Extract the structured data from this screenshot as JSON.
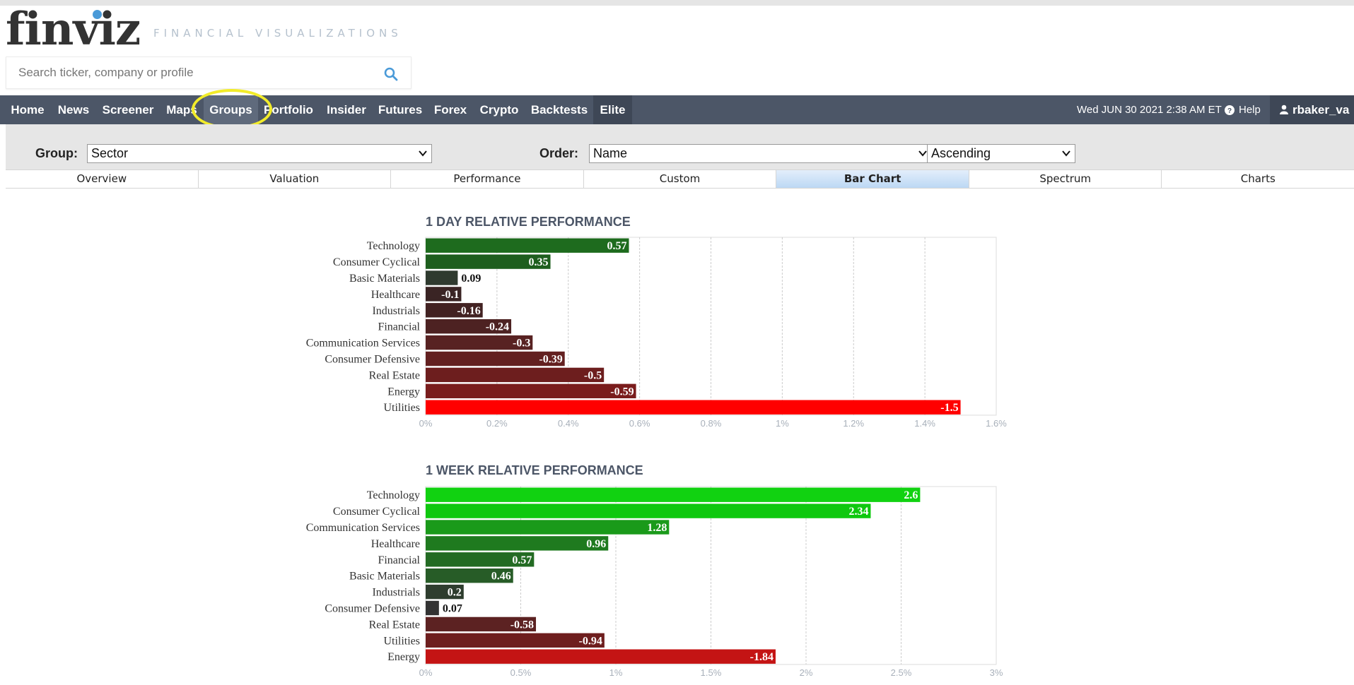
{
  "header": {
    "logo": "finviz",
    "tagline": "FINANCIAL VISUALIZATIONS",
    "search_placeholder": "Search ticker, company or profile"
  },
  "nav": {
    "items": [
      "Home",
      "News",
      "Screener",
      "Maps",
      "Groups",
      "Portfolio",
      "Insider",
      "Futures",
      "Forex",
      "Crypto",
      "Backtests",
      "Elite"
    ],
    "active": "Groups",
    "datetime": "Wed JUN 30 2021 2:38 AM ET",
    "help": "Help",
    "user": "rbaker_va"
  },
  "controls": {
    "group_label": "Group:",
    "group_value": "Sector",
    "order_label": "Order:",
    "order_value": "Name",
    "direction_value": "Ascending"
  },
  "tabs": [
    "Overview",
    "Valuation",
    "Performance",
    "Custom",
    "Bar Chart",
    "Spectrum",
    "Charts"
  ],
  "active_tab": "Bar Chart",
  "colors": {
    "nav_bg": "#4c5667",
    "highlight": "#f2ec2a",
    "positive_strong": "#00cc00",
    "negative_strong": "#ff0000"
  },
  "chart_data": [
    {
      "type": "bar",
      "title": "1 DAY RELATIVE PERFORMANCE",
      "categories": [
        "Technology",
        "Consumer Cyclical",
        "Basic Materials",
        "Healthcare",
        "Industrials",
        "Financial",
        "Communication Services",
        "Consumer Defensive",
        "Real Estate",
        "Energy",
        "Utilities"
      ],
      "values": [
        0.57,
        0.35,
        0.09,
        -0.1,
        -0.16,
        -0.24,
        -0.3,
        -0.39,
        -0.5,
        -0.59,
        -1.5
      ],
      "value_labels": [
        "0.57",
        "0.35",
        "0.09",
        "-0.1",
        "-0.16",
        "-0.24",
        "-0.3",
        "-0.39",
        "-0.5",
        "-0.59",
        "-1.5"
      ],
      "xlim": [
        0,
        1.6
      ],
      "xticks": [
        "0%",
        "0.2%",
        "0.4%",
        "0.6%",
        "0.8%",
        "1%",
        "1.2%",
        "1.4%",
        "1.6%"
      ],
      "bar_colors": [
        "#1e6b1e",
        "#1e5e1e",
        "#2f3a2f",
        "#3a2424",
        "#422222",
        "#4d2222",
        "#582222",
        "#632020",
        "#6d1e1e",
        "#7a1c1c",
        "#ff0000"
      ],
      "grid": true
    },
    {
      "type": "bar",
      "title": "1 WEEK RELATIVE PERFORMANCE",
      "categories": [
        "Technology",
        "Consumer Cyclical",
        "Communication Services",
        "Healthcare",
        "Financial",
        "Basic Materials",
        "Industrials",
        "Consumer Defensive",
        "Real Estate",
        "Utilities",
        "Energy"
      ],
      "values": [
        2.6,
        2.34,
        1.28,
        0.96,
        0.57,
        0.46,
        0.2,
        0.07,
        -0.58,
        -0.94,
        -1.84
      ],
      "value_labels": [
        "2.6",
        "2.34",
        "1.28",
        "0.96",
        "0.57",
        "0.46",
        "0.2",
        "0.07",
        "-0.58",
        "-0.94",
        "-1.84"
      ],
      "xlim": [
        0,
        3
      ],
      "xticks": [
        "0%",
        "0.5%",
        "1%",
        "1.5%",
        "2%",
        "2.5%",
        "3%"
      ],
      "bar_colors": [
        "#11d211",
        "#0ec80e",
        "#1a9a1a",
        "#1f7a1f",
        "#236b23",
        "#275c27",
        "#2e3d2e",
        "#333333",
        "#5c2222",
        "#6e1e1e",
        "#c41414"
      ],
      "grid": true
    }
  ]
}
